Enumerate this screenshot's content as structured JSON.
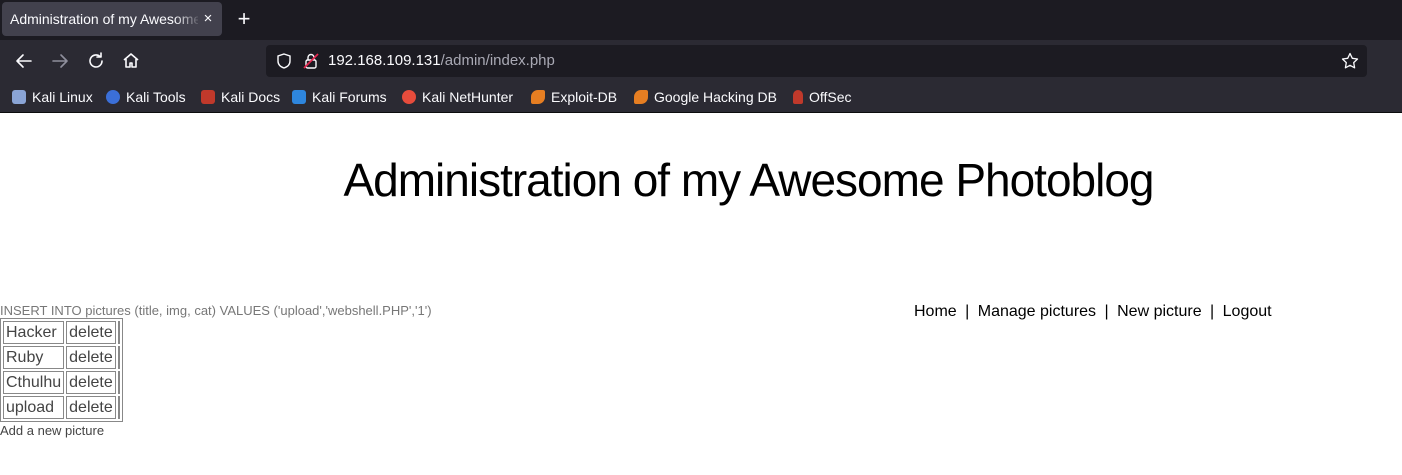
{
  "browser": {
    "tab_title": "Administration of my Awesome Photoblog",
    "tab_close": "×",
    "new_tab": "+",
    "url_host": "192.168.109.131",
    "url_path": "/admin/index.php",
    "bookmarks": [
      {
        "label": "Kali Linux",
        "icon": "kali-dragon-icon",
        "color": "#8aa4d6"
      },
      {
        "label": "Kali Tools",
        "icon": "kali-tools-icon",
        "color": "#3b6fd8"
      },
      {
        "label": "Kali Docs",
        "icon": "kali-docs-icon",
        "color": "#c0392b"
      },
      {
        "label": "Kali Forums",
        "icon": "kali-forums-icon",
        "color": "#2e86de"
      },
      {
        "label": "Kali NetHunter",
        "icon": "nethunter-icon",
        "color": "#e74c3c"
      },
      {
        "label": "Exploit-DB",
        "icon": "exploit-db-icon",
        "color": "#e67e22"
      },
      {
        "label": "Google Hacking DB",
        "icon": "ghdb-icon",
        "color": "#e67e22"
      },
      {
        "label": "OffSec",
        "icon": "offsec-icon",
        "color": "#c0392b"
      }
    ]
  },
  "page": {
    "heading": "Administration of my Awesome Photoblog",
    "sql_query": "INSERT INTO pictures (title, img, cat) VALUES ('upload','webshell.PHP','1')",
    "menu": {
      "home": "Home",
      "manage": "Manage pictures",
      "new": "New picture",
      "logout": "Logout",
      "separator": "|"
    },
    "pictures": [
      {
        "title": "Hacker",
        "action": "delete"
      },
      {
        "title": "Ruby",
        "action": "delete"
      },
      {
        "title": "Cthulhu",
        "action": "delete"
      },
      {
        "title": "upload",
        "action": "delete"
      }
    ],
    "add_link": "Add a new picture"
  }
}
